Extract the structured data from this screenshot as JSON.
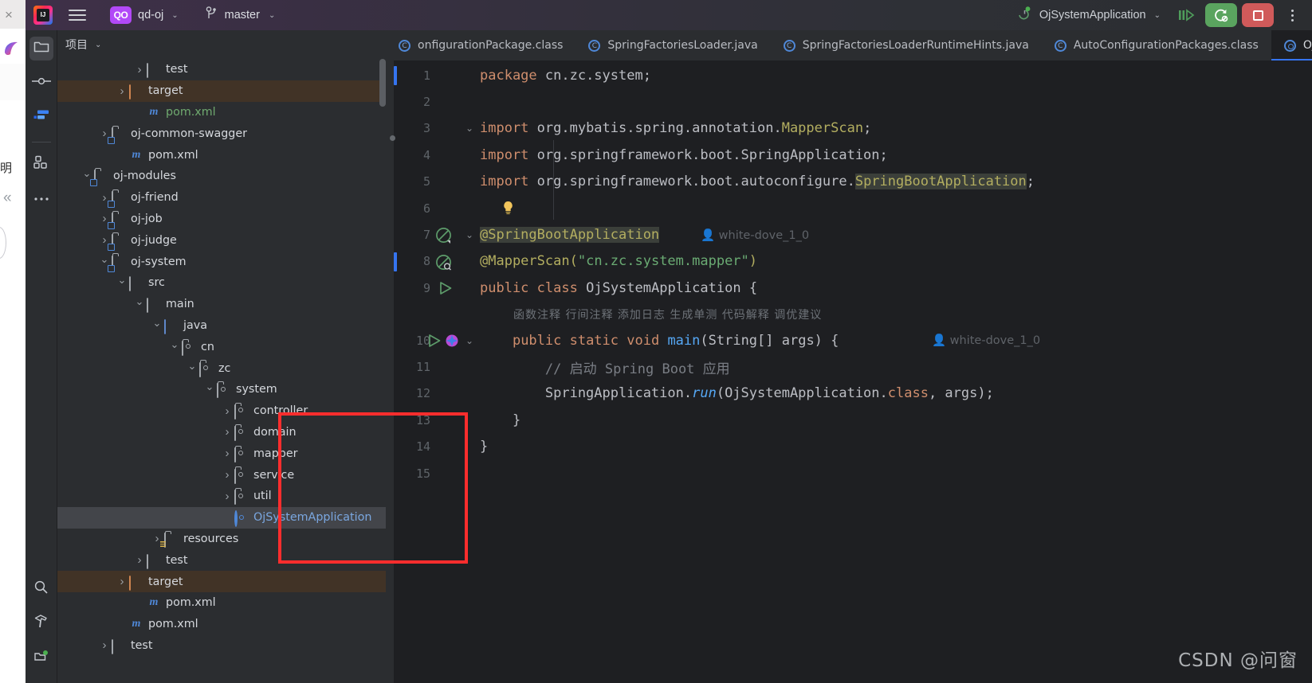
{
  "background_window": {
    "close_icon": "×",
    "cn_char": "明",
    "collapse_chevron": "«"
  },
  "toolbar": {
    "logo": "intellij-idea-logo",
    "menu_icon": "hamburger-menu-icon",
    "project_badge": "QO",
    "project_name": "qd-oj",
    "branch_icon": "vcs-branch-icon",
    "branch_name": "master",
    "run_config_icon": "spring-boot-run-config-icon",
    "run_config_name": "OjSystemApplication",
    "debug_label": "debug-button",
    "rerun_label": "rerun-button",
    "stop_label": "stop-button",
    "more_label": "more-actions-button",
    "chevron": "⌄"
  },
  "tool_rail": {
    "top_items": [
      {
        "name": "project-tool-window",
        "icon": "folder-icon",
        "active": true
      },
      {
        "name": "commit-tool-window",
        "icon": "commit-node-icon",
        "active": false
      },
      {
        "name": "pull-requests-tool-window",
        "icon": "blue-flag-icon",
        "active": false
      }
    ],
    "second_group": [
      {
        "name": "structure-tool-window",
        "icon": "structure-blocks-icon",
        "active": false
      },
      {
        "name": "more-tool-windows",
        "icon": "ellipsis-icon",
        "active": false
      }
    ],
    "bottom_items": [
      {
        "name": "search-everywhere",
        "icon": "search-icon"
      },
      {
        "name": "build-tool-window",
        "icon": "hammer-icon"
      },
      {
        "name": "services-tool-window",
        "icon": "services-icon"
      }
    ]
  },
  "project_panel": {
    "title": "项目",
    "chevron": "⌄",
    "tree": [
      {
        "depth": 4,
        "twisty": "right",
        "icon": "folder",
        "label": "test",
        "style": "plain"
      },
      {
        "depth": 3,
        "twisty": "right",
        "icon": "folder-orange",
        "label": "target",
        "style": "plain",
        "row": "target"
      },
      {
        "depth": 4,
        "twisty": "none",
        "icon": "maven",
        "label": "pom.xml",
        "style": "green"
      },
      {
        "depth": 2,
        "twisty": "right",
        "icon": "module",
        "label": "oj-common-swagger",
        "style": "plain"
      },
      {
        "depth": 3,
        "twisty": "none",
        "icon": "maven",
        "label": "pom.xml",
        "style": "plain"
      },
      {
        "depth": 1,
        "twisty": "down",
        "icon": "module",
        "label": "oj-modules",
        "style": "plain"
      },
      {
        "depth": 2,
        "twisty": "right",
        "icon": "module",
        "label": "oj-friend",
        "style": "plain"
      },
      {
        "depth": 2,
        "twisty": "right",
        "icon": "module",
        "label": "oj-job",
        "style": "plain"
      },
      {
        "depth": 2,
        "twisty": "right",
        "icon": "module",
        "label": "oj-judge",
        "style": "plain"
      },
      {
        "depth": 2,
        "twisty": "down",
        "icon": "module",
        "label": "oj-system",
        "style": "plain"
      },
      {
        "depth": 3,
        "twisty": "down",
        "icon": "folder",
        "label": "src",
        "style": "plain"
      },
      {
        "depth": 4,
        "twisty": "down",
        "icon": "folder",
        "label": "main",
        "style": "plain"
      },
      {
        "depth": 5,
        "twisty": "down",
        "icon": "folder-blue",
        "label": "java",
        "style": "plain"
      },
      {
        "depth": 6,
        "twisty": "down",
        "icon": "package",
        "label": "cn",
        "style": "plain"
      },
      {
        "depth": 7,
        "twisty": "down",
        "icon": "package",
        "label": "zc",
        "style": "plain"
      },
      {
        "depth": 8,
        "twisty": "down",
        "icon": "package",
        "label": "system",
        "style": "plain"
      },
      {
        "depth": 9,
        "twisty": "right",
        "icon": "package",
        "label": "controller",
        "style": "plain"
      },
      {
        "depth": 9,
        "twisty": "right",
        "icon": "package",
        "label": "domain",
        "style": "plain"
      },
      {
        "depth": 9,
        "twisty": "right",
        "icon": "package",
        "label": "mapper",
        "style": "plain"
      },
      {
        "depth": 9,
        "twisty": "right",
        "icon": "package",
        "label": "service",
        "style": "plain"
      },
      {
        "depth": 9,
        "twisty": "right",
        "icon": "package",
        "label": "util",
        "style": "plain"
      },
      {
        "depth": 9,
        "twisty": "none",
        "icon": "springclass",
        "label": "OjSystemApplication",
        "style": "lblue",
        "row": "selected"
      },
      {
        "depth": 5,
        "twisty": "right",
        "icon": "resources",
        "label": "resources",
        "style": "plain"
      },
      {
        "depth": 4,
        "twisty": "right",
        "icon": "folder",
        "label": "test",
        "style": "plain"
      },
      {
        "depth": 3,
        "twisty": "right",
        "icon": "folder-orange",
        "label": "target",
        "style": "plain",
        "row": "target"
      },
      {
        "depth": 4,
        "twisty": "none",
        "icon": "maven",
        "label": "pom.xml",
        "style": "plain"
      },
      {
        "depth": 3,
        "twisty": "none",
        "icon": "maven",
        "label": "pom.xml",
        "style": "plain"
      },
      {
        "depth": 2,
        "twisty": "right",
        "icon": "folder",
        "label": "test",
        "style": "plain"
      }
    ]
  },
  "editor": {
    "tabs": [
      {
        "label": "onfigurationPackage.class",
        "icon": "class-icon",
        "active": false,
        "clipped": true
      },
      {
        "label": "SpringFactoriesLoader.java",
        "icon": "class-icon",
        "active": false
      },
      {
        "label": "SpringFactoriesLoaderRuntimeHints.java",
        "icon": "class-icon",
        "active": false
      },
      {
        "label": "AutoConfigurationPackages.class",
        "icon": "class-icon",
        "active": false
      },
      {
        "label": "Oj",
        "icon": "spring-class-icon",
        "active": true,
        "clipped": true
      }
    ],
    "inlay_hints": "函数注释  行间注释  添加日志  生成单测  代码解释  调优建议",
    "author_annotation": "white-dove_1_0",
    "lines": [
      {
        "no": "1",
        "caret": true
      },
      {
        "no": "2"
      },
      {
        "no": "3",
        "fold": "⌄"
      },
      {
        "no": "4",
        "modified_dot": true
      },
      {
        "no": "5"
      },
      {
        "no": "6",
        "bulb": true
      },
      {
        "no": "7",
        "fold": "⌄",
        "gutter": "spring-bean-icon",
        "author": "white-dove_1_0"
      },
      {
        "no": "8",
        "caret": true,
        "gutter": "spring-bean-search-icon"
      },
      {
        "no": "9",
        "gutter": "run-icon"
      },
      {
        "no": "10",
        "gutter": "run-icon + ai-icon",
        "fold": "⌄",
        "author": "white-dove_1_0"
      },
      {
        "no": "11"
      },
      {
        "no": "12"
      },
      {
        "no": "13"
      },
      {
        "no": "14"
      },
      {
        "no": "15"
      }
    ],
    "code": {
      "l1_kw": "package",
      "l1_rest": " cn.zc.system;",
      "l3_kw": "import",
      "l3_a": " org.mybatis.spring.annotation.",
      "l3_hl": "MapperScan",
      "l3_end": ";",
      "l4_kw": "import",
      "l4_rest": " org.springframework.boot.SpringApplication;",
      "l5_kw": "import",
      "l5_a": " org.springframework.boot.autoconfigure.",
      "l5_hl": "SpringBootApplication",
      "l5_end": ";",
      "l7_ann": "@SpringBootApplication",
      "l8_ann": "@MapperScan",
      "l8_open": "(",
      "l8_str": "\"cn.zc.system.mapper\"",
      "l8_close": ")",
      "l9_kw1": "public",
      "l9_kw2": "class",
      "l9_name": "OjSystemApplication",
      "l9_brace": "{",
      "l10_kw": "public static void",
      "l10_mth": "main",
      "l10_args": "(String[] args) {",
      "l11_cmt": "// 启动 Spring Boot 应用",
      "l12_a": "SpringApplication.",
      "l12_run": "run",
      "l12_b": "(OjSystemApplication.",
      "l12_class": "class",
      "l12_c": ", args);",
      "l13_brace": "}",
      "l14_brace": "}"
    }
  },
  "annotation": {
    "red_box": "red-highlight-rectangle"
  },
  "watermark": "CSDN @问窗",
  "colors": {
    "accent_blue": "#3574f0",
    "run_green": "#5aa45f",
    "stop_red": "#d05a5a",
    "annotation_red": "#ff2d2d",
    "editor_bg": "#1e1f22",
    "panel_bg": "#2b2d30",
    "target_row": "#413326",
    "selected_row": "#43454a"
  }
}
